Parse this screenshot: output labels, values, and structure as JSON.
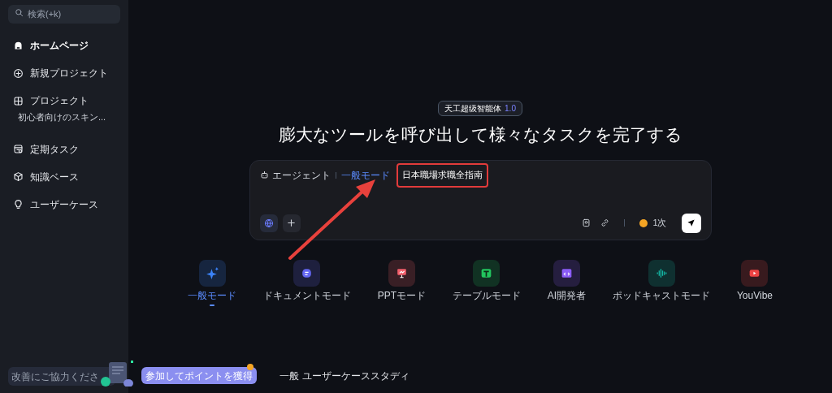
{
  "sidebar": {
    "search": {
      "placeholder": "検索(+k)"
    },
    "items": [
      {
        "label": "ホームページ",
        "kind": "home",
        "selected": true
      },
      {
        "label": "新規プロジェクト",
        "kind": "plus",
        "selected": false
      },
      {
        "label": "プロジェクト",
        "kind": "grid",
        "selected": false,
        "children": [
          {
            "label": "初心者向けのスキン..."
          }
        ]
      },
      {
        "label": "定期タスク",
        "kind": "calendar",
        "selected": false
      },
      {
        "label": "知識ベース",
        "kind": "cube",
        "selected": false
      },
      {
        "label": "ユーザーケース",
        "kind": "bulb",
        "selected": false
      }
    ],
    "feedback": {
      "text": "改善にご協力くださ",
      "tooltip": "参加してポイントを獲得"
    }
  },
  "main": {
    "badge": {
      "name": "天工超级智能体",
      "version": "1.0"
    },
    "heading": "膨大なツールを呼び出して様々なタスクを完了する",
    "composer": {
      "agent_label": "エージェント",
      "mode_label": "一般モード",
      "value": "日本職場求職全指南",
      "credits": "1次"
    },
    "modes": [
      {
        "label": "一般モード",
        "kind": "sparkle",
        "color": "#3b82f6",
        "selected": true
      },
      {
        "label": "ドキュメントモード",
        "kind": "doc",
        "color": "#6366f1",
        "selected": false
      },
      {
        "label": "PPTモード",
        "kind": "ppt",
        "color": "#f25f6b",
        "selected": false
      },
      {
        "label": "テーブルモード",
        "kind": "table",
        "color": "#22c55e",
        "selected": false
      },
      {
        "label": "AI開発者",
        "kind": "code",
        "color": "#8b5cf6",
        "selected": false
      },
      {
        "label": "ポッドキャストモード",
        "kind": "wave",
        "color": "#14b8a6",
        "selected": false
      },
      {
        "label": "YouVibe",
        "kind": "play",
        "color": "#ef4444",
        "selected": false
      }
    ],
    "footer_tabs": [
      "一般",
      "ユーザーケーススタディ"
    ]
  }
}
